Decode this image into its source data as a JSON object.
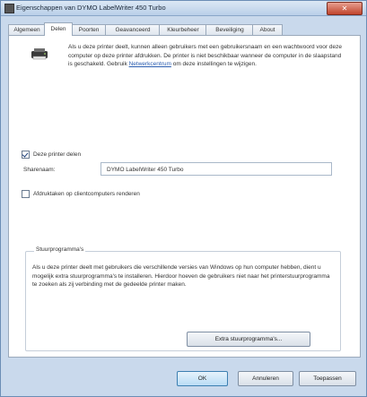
{
  "window": {
    "title": "Eigenschappen van DYMO LabelWriter 450 Turbo",
    "close_label": "✕"
  },
  "tabs": [
    {
      "label": "Algemeen",
      "active": false
    },
    {
      "label": "Delen",
      "active": true
    },
    {
      "label": "Poorten",
      "active": false
    },
    {
      "label": "Geavanceerd",
      "active": false
    },
    {
      "label": "Kleurbeheer",
      "active": false
    },
    {
      "label": "Beveiliging",
      "active": false
    },
    {
      "label": "About",
      "active": false
    }
  ],
  "sharing": {
    "info_text": "Als u deze printer deelt, kunnen alleen gebruikers met een gebruikersnaam en een wachtwoord voor deze computer op deze printer afdrukken. De printer is niet beschikbaar wanneer de computer in de slaapstand is geschakeld. Gebruik",
    "info_link": "Netwerkcentrum",
    "info_tail": "om deze instellingen te wijzigen.",
    "share_checkbox_label": "Deze printer delen",
    "share_checked": true,
    "share_name_label": "Sharenaam:",
    "share_name_value": "DYMO LabelWriter 450 Turbo",
    "render_checkbox_label": "Afdruktaken op clientcomputers renderen",
    "render_checked": false
  },
  "drivers": {
    "group_title": "Stuurprogramma's",
    "text": "Als u deze printer deelt met gebruikers die verschillende versies van Windows op hun computer hebben, dient u mogelijk extra stuurprogramma's te installeren. Hierdoor hoeven de gebruikers niet naar het printerstuurprogramma te zoeken als zij verbinding met de gedeelde printer maken.",
    "button_label": "Extra stuurprogramma's..."
  },
  "footer": {
    "ok_label": "OK",
    "cancel_label": "Annuleren",
    "apply_label": "Toepassen"
  }
}
